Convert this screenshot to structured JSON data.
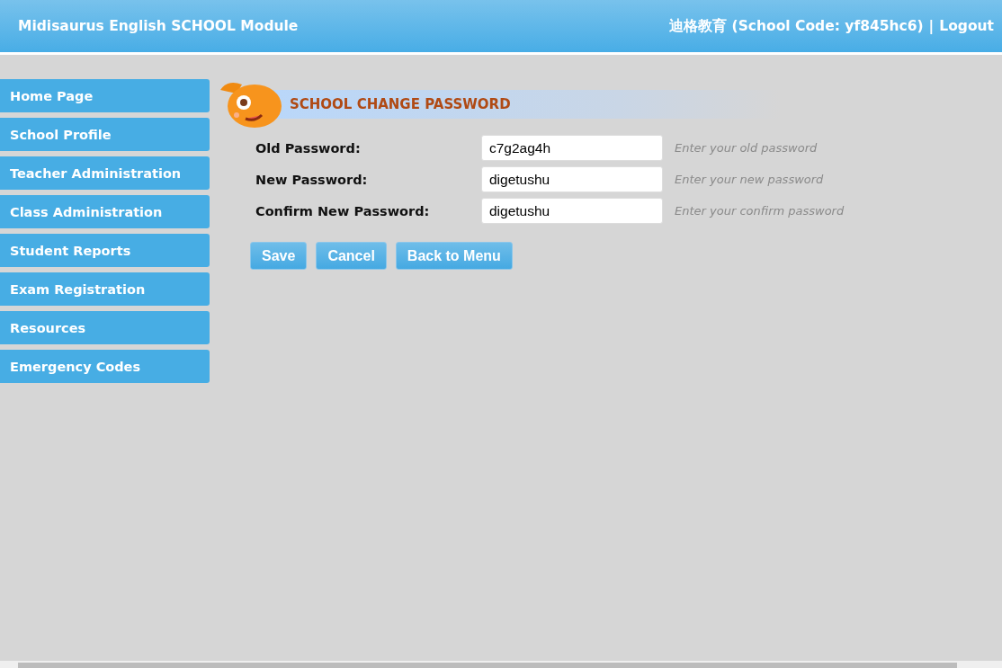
{
  "header": {
    "title": "Midisaurus English SCHOOL Module",
    "school": "迪格教育 (School Code: yf845hc6)",
    "separator": "|",
    "logout": "Logout"
  },
  "sidebar": {
    "items": [
      {
        "label": "Home Page"
      },
      {
        "label": "School Profile"
      },
      {
        "label": "Teacher Administration"
      },
      {
        "label": "Class Administration"
      },
      {
        "label": "Student Reports"
      },
      {
        "label": "Exam Registration"
      },
      {
        "label": "Resources"
      },
      {
        "label": "Emergency Codes"
      }
    ]
  },
  "page": {
    "title": "SCHOOL CHANGE PASSWORD"
  },
  "form": {
    "fields": [
      {
        "label": "Old Password:",
        "value": "c7g2ag4h",
        "hint": "Enter your old password"
      },
      {
        "label": "New Password:",
        "value": "digetushu",
        "hint": "Enter your new password"
      },
      {
        "label": "Confirm New Password:",
        "value": "digetushu",
        "hint": "Enter your confirm password"
      }
    ]
  },
  "buttons": [
    "Save",
    "Cancel",
    "Back to Menu"
  ]
}
